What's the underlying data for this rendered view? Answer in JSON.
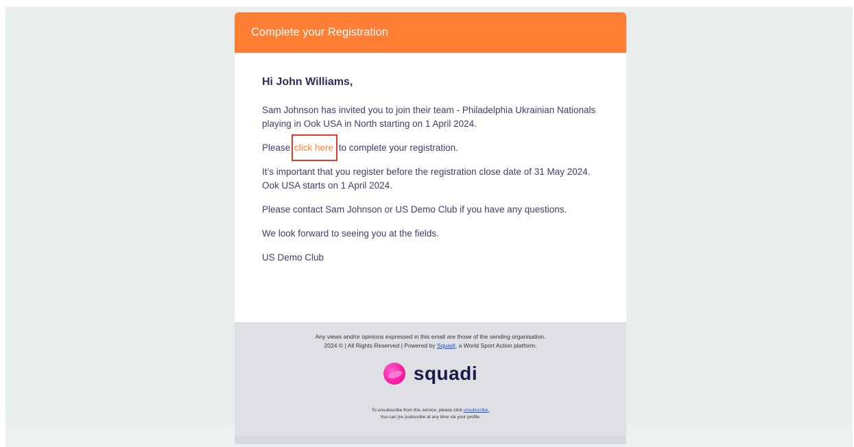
{
  "email": {
    "header_title": "Complete your Registration",
    "greeting": "Hi John Williams,",
    "para_invite": "Sam Johnson has invited you to join their team - Philadelphia Ukrainian Nationals playing in Ook USA in North starting on 1 April 2024.",
    "para_click_before": "Please ",
    "para_click_link": "click here",
    "para_click_after": " to complete your registration.",
    "para_deadline": "It’s important that you register before the registration close date of 31 May 2024. Ook USA starts on 1 April 2024.",
    "para_contact": "Please contact Sam Johnson or US Demo Club if you have any questions.",
    "para_lookforward": "We look forward to seeing you at the fields.",
    "signature": "US Demo Club"
  },
  "footer": {
    "disclaimer": "Any views and/or opinions expressed in this email are those of the sending organisation.",
    "copyright_before": "2024 © | All Rights Reserved | Powered by ",
    "squadi_link": "Squadi",
    "copyright_after": ", a World Sport Action platform.",
    "logo_text": "squadi",
    "unsub_before": "To unsubscribe from this service, please click ",
    "unsub_link": "unsubscribe.",
    "resubscribe": "You can (re-)subscribe at any time via your profile."
  },
  "colors": {
    "header_bg": "#ff7e33",
    "link_orange": "#ff7e33",
    "highlight_box": "#e0392b",
    "text_navy": "#3e3e68",
    "footer_bg": "#dfe0e4",
    "logo_pink": "#ff2aa9"
  }
}
